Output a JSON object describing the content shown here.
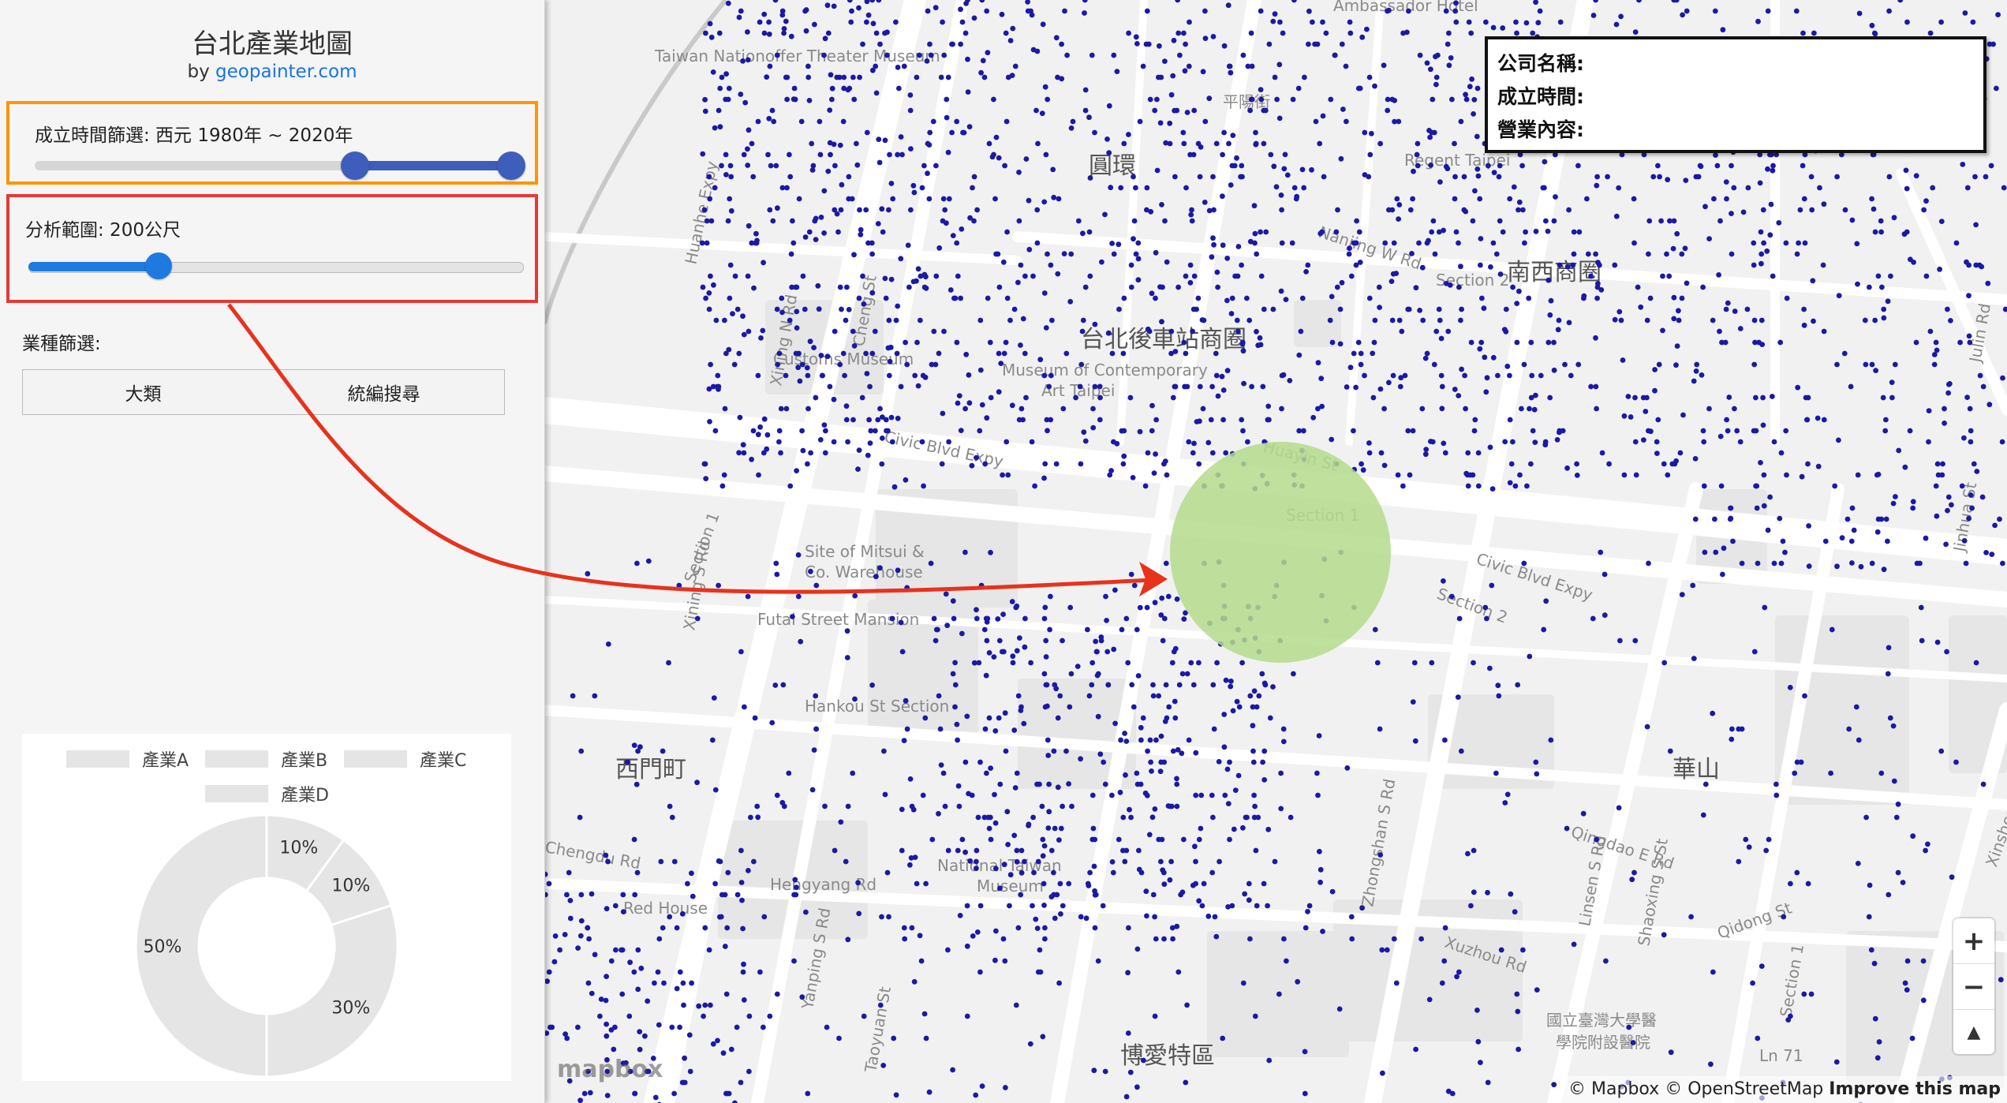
{
  "sidebar": {
    "title": "台北產業地圖",
    "by_prefix": "by ",
    "by_link": "geopainter.com",
    "time_filter": {
      "label": "成立時間篩選: 西元 1980年 ~ 2020年",
      "min": 1980,
      "max": 2020
    },
    "range_filter": {
      "label": "分析範圍: 200公尺",
      "value": 200
    },
    "industry_label": "業種篩選:",
    "tabs": [
      "大類",
      "統編搜尋"
    ],
    "chart_legend": [
      "產業A",
      "產業B",
      "產業C",
      "產業D"
    ]
  },
  "chart_data": {
    "type": "pie",
    "categories": [
      "產業A",
      "產業B",
      "產業C",
      "產業D"
    ],
    "values": [
      10,
      10,
      30,
      50
    ],
    "labels": [
      "10%",
      "10%",
      "30%",
      "50%"
    ],
    "donut": true,
    "color": "#e5e5e5"
  },
  "info_box": {
    "name_label": "公司名稱:",
    "founded_label": "成立時間:",
    "business_label": "營業內容:"
  },
  "map": {
    "districts": [
      "圓環",
      "南西商圈",
      "台北後車站商圈",
      "西門町",
      "華山",
      "博愛特區"
    ],
    "labels": [
      "Taiwan Nationoffer Theater Museum",
      "Ambassador Hotel",
      "平陽街",
      "Nanjing W Rd",
      "Regent Taipei",
      "Section 2",
      "Huanhe Expy",
      "Xining N Rd",
      "Cheng St",
      "Customs Museum",
      "Museum of Contemporary",
      "Art Taipei",
      "Huayin St",
      "Civic Blvd Expy",
      "Section 1",
      "Civic Blvd Expy",
      "Section 2",
      "Section 1",
      "Site of Mitsui &",
      "Co. Warehouse",
      "Futai Street Mansion",
      "Xining S Rd",
      "Hankou St Section",
      "Zhongshan S Rd",
      "Qingdao E Rd",
      "Linsen S Rd",
      "Shaoxing S St",
      "Jinshan St",
      "Xinsheng Expy",
      "Jinhua St",
      "National Taiwan",
      "Museum",
      "Hengyang Rd",
      "Red House",
      "Yanping S Rd",
      "Taoyuan St",
      "Xuzhou Rd",
      "Qidong St",
      "國立臺灣大學醫",
      "學院附設醫院",
      "Section 1",
      "Ln 71",
      "Chengdu Rd",
      "Julin Rd"
    ],
    "dot_color": "#1a1aa6",
    "circle_color": "#b5dc8c"
  },
  "zoom": {
    "in": "+",
    "out": "−",
    "compass": "▲"
  },
  "attribution": {
    "mapbox": "© Mapbox",
    "osm": "© OpenStreetMap",
    "improve": "Improve this map"
  },
  "logo": "mapbox"
}
